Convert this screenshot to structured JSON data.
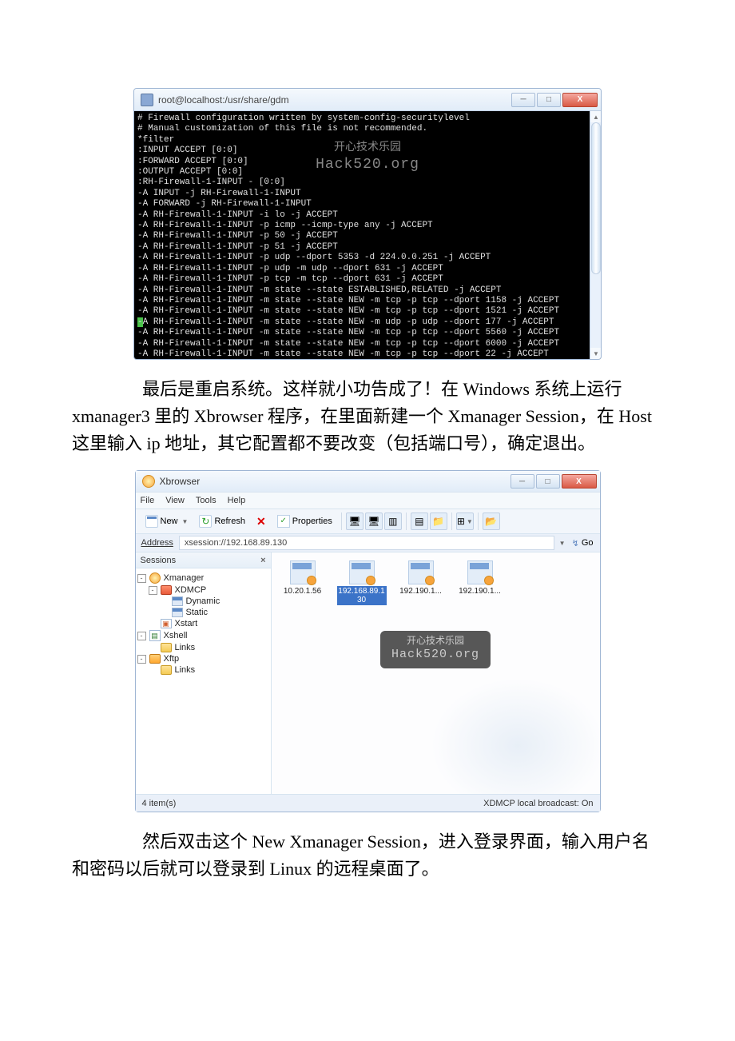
{
  "terminal": {
    "title": "root@localhost:/usr/share/gdm",
    "watermark_zh": "开心技术乐园",
    "watermark_en": "Hack520.org",
    "lines": [
      "# Firewall configuration written by system-config-securitylevel",
      "# Manual customization of this file is not recommended.",
      "*filter",
      ":INPUT ACCEPT [0:0]",
      ":FORWARD ACCEPT [0:0]",
      ":OUTPUT ACCEPT [0:0]",
      ":RH-Firewall-1-INPUT - [0:0]",
      "-A INPUT -j RH-Firewall-1-INPUT",
      "-A FORWARD -j RH-Firewall-1-INPUT",
      "-A RH-Firewall-1-INPUT -i lo -j ACCEPT",
      "-A RH-Firewall-1-INPUT -p icmp --icmp-type any -j ACCEPT",
      "-A RH-Firewall-1-INPUT -p 50 -j ACCEPT",
      "-A RH-Firewall-1-INPUT -p 51 -j ACCEPT",
      "-A RH-Firewall-1-INPUT -p udp --dport 5353 -d 224.0.0.251 -j ACCEPT",
      "-A RH-Firewall-1-INPUT -p udp -m udp --dport 631 -j ACCEPT",
      "-A RH-Firewall-1-INPUT -p tcp -m tcp --dport 631 -j ACCEPT",
      "-A RH-Firewall-1-INPUT -m state --state ESTABLISHED,RELATED -j ACCEPT",
      "-A RH-Firewall-1-INPUT -m state --state NEW -m tcp -p tcp --dport 1158 -j ACCEPT",
      "-A RH-Firewall-1-INPUT -m state --state NEW -m tcp -p tcp --dport 1521 -j ACCEPT",
      "-A RH-Firewall-1-INPUT -m state --state NEW -m udp -p udp --dport 177 -j ACCEPT",
      "-A RH-Firewall-1-INPUT -m state --state NEW -m tcp -p tcp --dport 5560 -j ACCEPT",
      "-A RH-Firewall-1-INPUT -m state --state NEW -m tcp -p tcp --dport 6000 -j ACCEPT",
      "-A RH-Firewall-1-INPUT -m state --state NEW -m tcp -p tcp --dport 22 -j ACCEPT"
    ]
  },
  "para1_pre": "　　　　最后是重启系统。这样就小功告成了！在 ",
  "para1_w1": "Windows ",
  "para1_m1": "系统上运行 ",
  "para1_w2": "xmanager3 ",
  "para1_m2": "里的 ",
  "para1_w3": "Xbrowser ",
  "para1_m3": "程序，在里面新建一个 ",
  "para1_w4": "Xmanager Session",
  "para1_m4": "，在 ",
  "para1_w5": "Host ",
  "para1_m5": "这里输入 ",
  "para1_w6": "ip ",
  "para1_m6": "地址，其它配置都不要改变（包括端口号），确定退出。",
  "xbrowser": {
    "title": "Xbrowser",
    "menu": [
      "File",
      "View",
      "Tools",
      "Help"
    ],
    "toolbar": {
      "new": "New",
      "refresh": "Refresh",
      "properties": "Properties"
    },
    "address_label": "Address",
    "address": "xsession://192.168.89.130",
    "go": "Go",
    "sessions_header": "Sessions",
    "tree": {
      "xmanager": "Xmanager",
      "xdmcp": "XDMCP",
      "dynamic": "Dynamic",
      "static": "Static",
      "xstart": "Xstart",
      "xshell": "Xshell",
      "xshell_links": "Links",
      "xftp": "Xftp",
      "xftp_links": "Links"
    },
    "items": [
      {
        "label": "10.20.1.56",
        "selected": false
      },
      {
        "label": "192.168.89.130",
        "selected": true
      },
      {
        "label": "192.190.1...",
        "selected": false
      },
      {
        "label": "192.190.1...",
        "selected": false
      }
    ],
    "watermark_zh": "开心技术乐园",
    "watermark_en": "Hack520.org",
    "status_left": "4 item(s)",
    "status_right": "XDMCP local broadcast: On"
  },
  "para2_pre": "　　　　然后双击这个 ",
  "para2_w1": "New Xmanager Session",
  "para2_m1": "，进入登录界面，输入用户名和密码以后就可以登录到 ",
  "para2_w2": "Linux ",
  "para2_m2": "的远程桌面了。"
}
